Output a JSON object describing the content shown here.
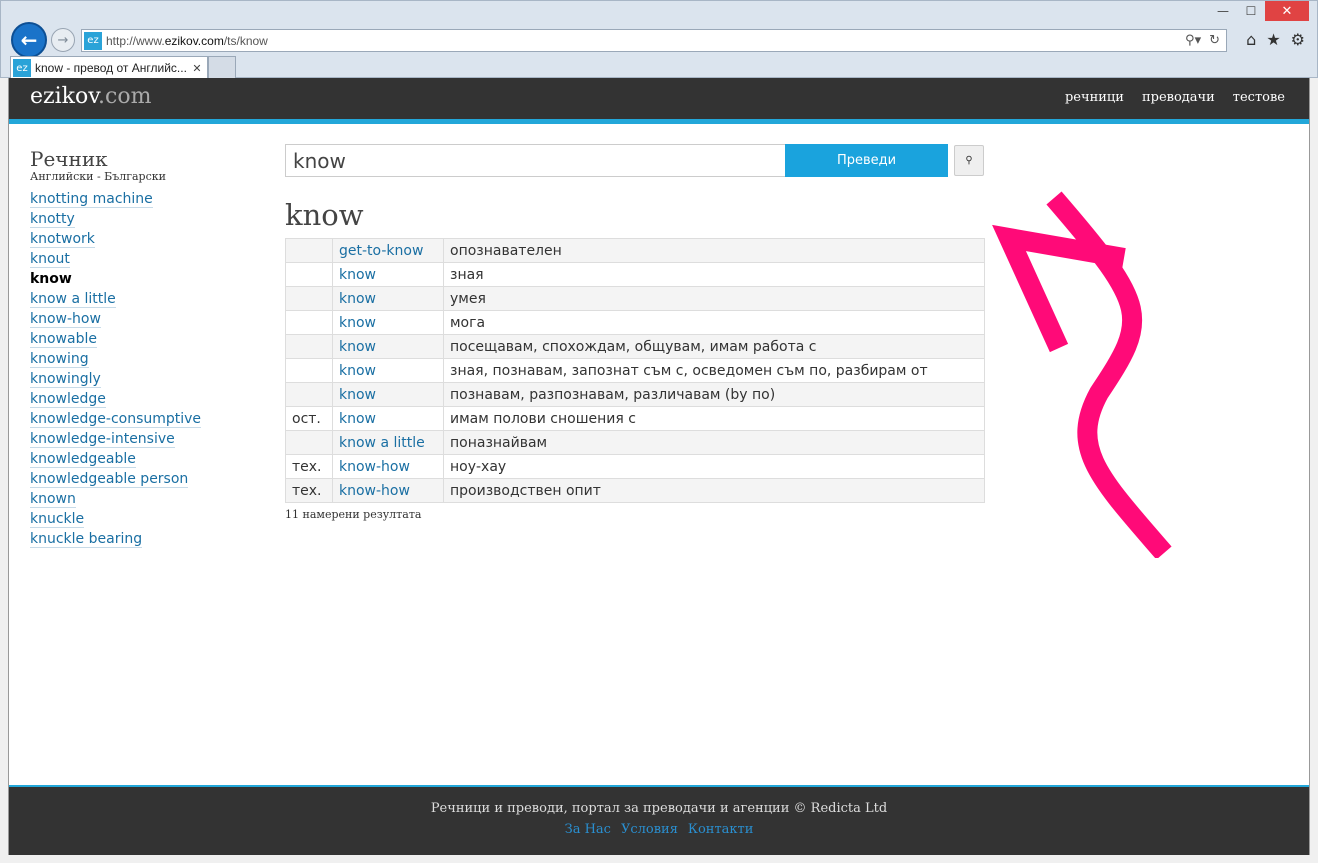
{
  "browser": {
    "url_prefix": "http://www.",
    "url_domain": "ezikov.com",
    "url_path": "/ts/know",
    "favicon_text": "ez",
    "tab_title": "know - превод от Английс..."
  },
  "header": {
    "logo_main": "ezikov",
    "logo_suffix": ".com",
    "nav": [
      "речници",
      "преводачи",
      "тестове"
    ]
  },
  "sidebar": {
    "title": "Речник",
    "subtitle": "Английски - Български",
    "words": [
      "knotting machine",
      "knotty",
      "knotwork",
      "knout",
      "know",
      "know a little",
      "know-how",
      "knowable",
      "knowing",
      "knowingly",
      "knowledge",
      "knowledge-consumptive",
      "knowledge-intensive",
      "knowledgeable",
      "knowledgeable person",
      "known",
      "knuckle",
      "knuckle bearing"
    ],
    "current": "know"
  },
  "search": {
    "value": "know",
    "button_label": "Преведи",
    "small_button_icon": "search-icon"
  },
  "result_title": "know",
  "results": [
    {
      "note": "",
      "word": "get-to-know",
      "translation": "опознавателен"
    },
    {
      "note": "",
      "word": "know",
      "translation": "зная"
    },
    {
      "note": "",
      "word": "know",
      "translation": "умея"
    },
    {
      "note": "",
      "word": "know",
      "translation": "мога"
    },
    {
      "note": "",
      "word": "know",
      "translation": "посещавам, спохождам, общувам, имам работа с"
    },
    {
      "note": "",
      "word": "know",
      "translation": "зная, познавам, запознат съм с, осведомен съм по, разбирам от"
    },
    {
      "note": "",
      "word": "know",
      "translation": "познавам, разпознавам, различавам (by по)"
    },
    {
      "note": "ост.",
      "word": "know",
      "translation": "имам полови сношения с"
    },
    {
      "note": "",
      "word": "know a little",
      "translation": "поназнайвам"
    },
    {
      "note": "тех.",
      "word": "know-how",
      "translation": "ноу-хау"
    },
    {
      "note": "тех.",
      "word": "know-how",
      "translation": "производствен опит"
    }
  ],
  "results_count": "11 намерени резултата",
  "footer": {
    "text": "Речници и преводи, портал за преводачи и агенции © Redicta Ltd",
    "links": [
      "За Нас",
      "Условия",
      "Контакти"
    ]
  },
  "colors": {
    "accent": "#22a7d9",
    "annotation_arrow": "#ff0a78"
  }
}
